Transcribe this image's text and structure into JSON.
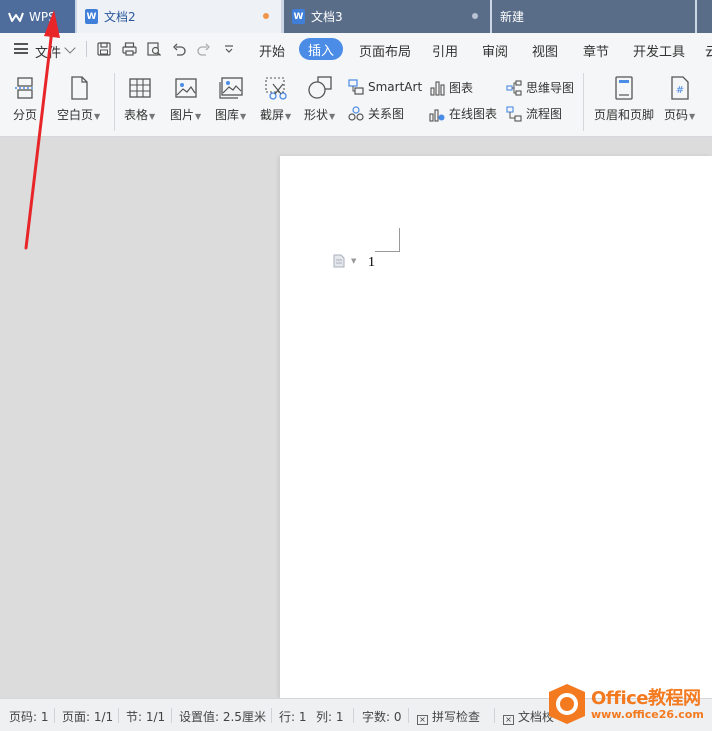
{
  "tabs": {
    "wps": "WPS",
    "doc2": "文档2",
    "doc3": "文档3",
    "new": "新建"
  },
  "menubar": {
    "file": "文件",
    "items": [
      "开始",
      "插入",
      "页面布局",
      "引用",
      "审阅",
      "视图",
      "章节",
      "开发工具",
      "云"
    ],
    "active": "插入"
  },
  "ribbon": {
    "page_break": "分页",
    "blank_page": "空白页",
    "table": "表格",
    "picture": "图片",
    "gallery": "图库",
    "screenshot": "截屏",
    "shape": "形状",
    "smartart": "SmartArt",
    "relation": "关系图",
    "chart": "图表",
    "online_chart": "在线图表",
    "mindmap": "思维导图",
    "flowchart": "流程图",
    "header_footer": "页眉和页脚",
    "page_number": "页码"
  },
  "document": {
    "text": "1"
  },
  "statusbar": {
    "page_num": "页码: 1",
    "pages": "页面: 1/1",
    "section": "节: 1/1",
    "setting": "设置值: 2.5厘米",
    "row": "行: 1",
    "col": "列: 1",
    "word_count": "字数: 0",
    "spell_check": "拼写检查",
    "doc_check": "文档校"
  },
  "watermark": {
    "title": "Office教程网",
    "url": "www.office26.com"
  },
  "colors": {
    "accent": "#4b8ce6",
    "tab_active_bg": "#eef2f7",
    "tab_inactive_bg": "#5a6d88",
    "wps_tab_bg": "#4e6d9c",
    "modified_dot": "#f0954c",
    "watermark_orange": "#f47a20",
    "annotation_arrow": "#e8262a"
  }
}
